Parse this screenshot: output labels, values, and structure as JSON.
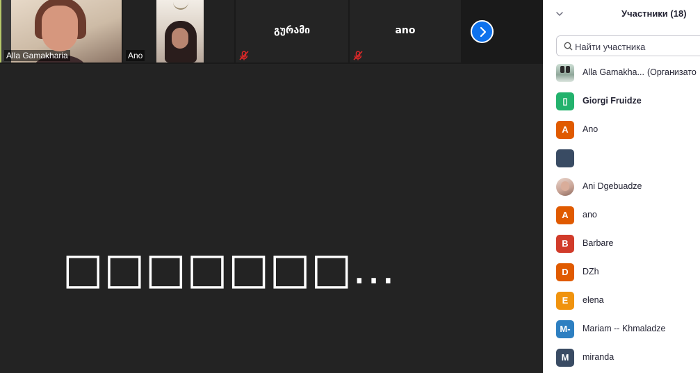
{
  "video_strip": {
    "tiles": [
      {
        "name": "Alla Gamakharia",
        "has_video": true
      },
      {
        "name": "Ano",
        "has_video": true
      },
      {
        "name": "გურამი",
        "muted": true
      },
      {
        "name": "ano",
        "muted": true
      }
    ],
    "next_icon": "chevron-right-icon"
  },
  "stage": {
    "status_text": "□□□□□□□..."
  },
  "panel": {
    "title": "Участники (18)",
    "search_placeholder": "Найти участника",
    "participants": [
      {
        "name": "Alla Gamakha...",
        "role": "(Организато",
        "avatar_letter": "",
        "avatar_color": "#8fa79a",
        "avatar_type": "photo1"
      },
      {
        "name": "Giorgi Fruidze",
        "avatar_letter": "▯",
        "avatar_color": "#23b26d",
        "bold": true
      },
      {
        "name": "Ano",
        "avatar_letter": "A",
        "avatar_color": "#e05a00"
      },
      {
        "name": "",
        "avatar_letter": "",
        "avatar_color": "#394b63"
      },
      {
        "name": "Ani Dgebuadze",
        "avatar_letter": "",
        "avatar_color": "#c7a294",
        "avatar_type": "photo2"
      },
      {
        "name": "ano",
        "avatar_letter": "A",
        "avatar_color": "#e05a00"
      },
      {
        "name": "Barbare",
        "avatar_letter": "B",
        "avatar_color": "#d13b2a"
      },
      {
        "name": "DZh",
        "avatar_letter": "D",
        "avatar_color": "#e05a00"
      },
      {
        "name": "elena",
        "avatar_letter": "E",
        "avatar_color": "#f0930e"
      },
      {
        "name": "Mariam -- Khmaladze",
        "avatar_letter": "M-",
        "avatar_color": "#2d7fc1"
      },
      {
        "name": "miranda",
        "avatar_letter": "M",
        "avatar_color": "#394b63"
      }
    ]
  },
  "colors": {
    "accent": "#0e72ed",
    "stage_bg": "#232323",
    "panel_bg": "#ffffff",
    "muted_icon": "#e02828"
  }
}
